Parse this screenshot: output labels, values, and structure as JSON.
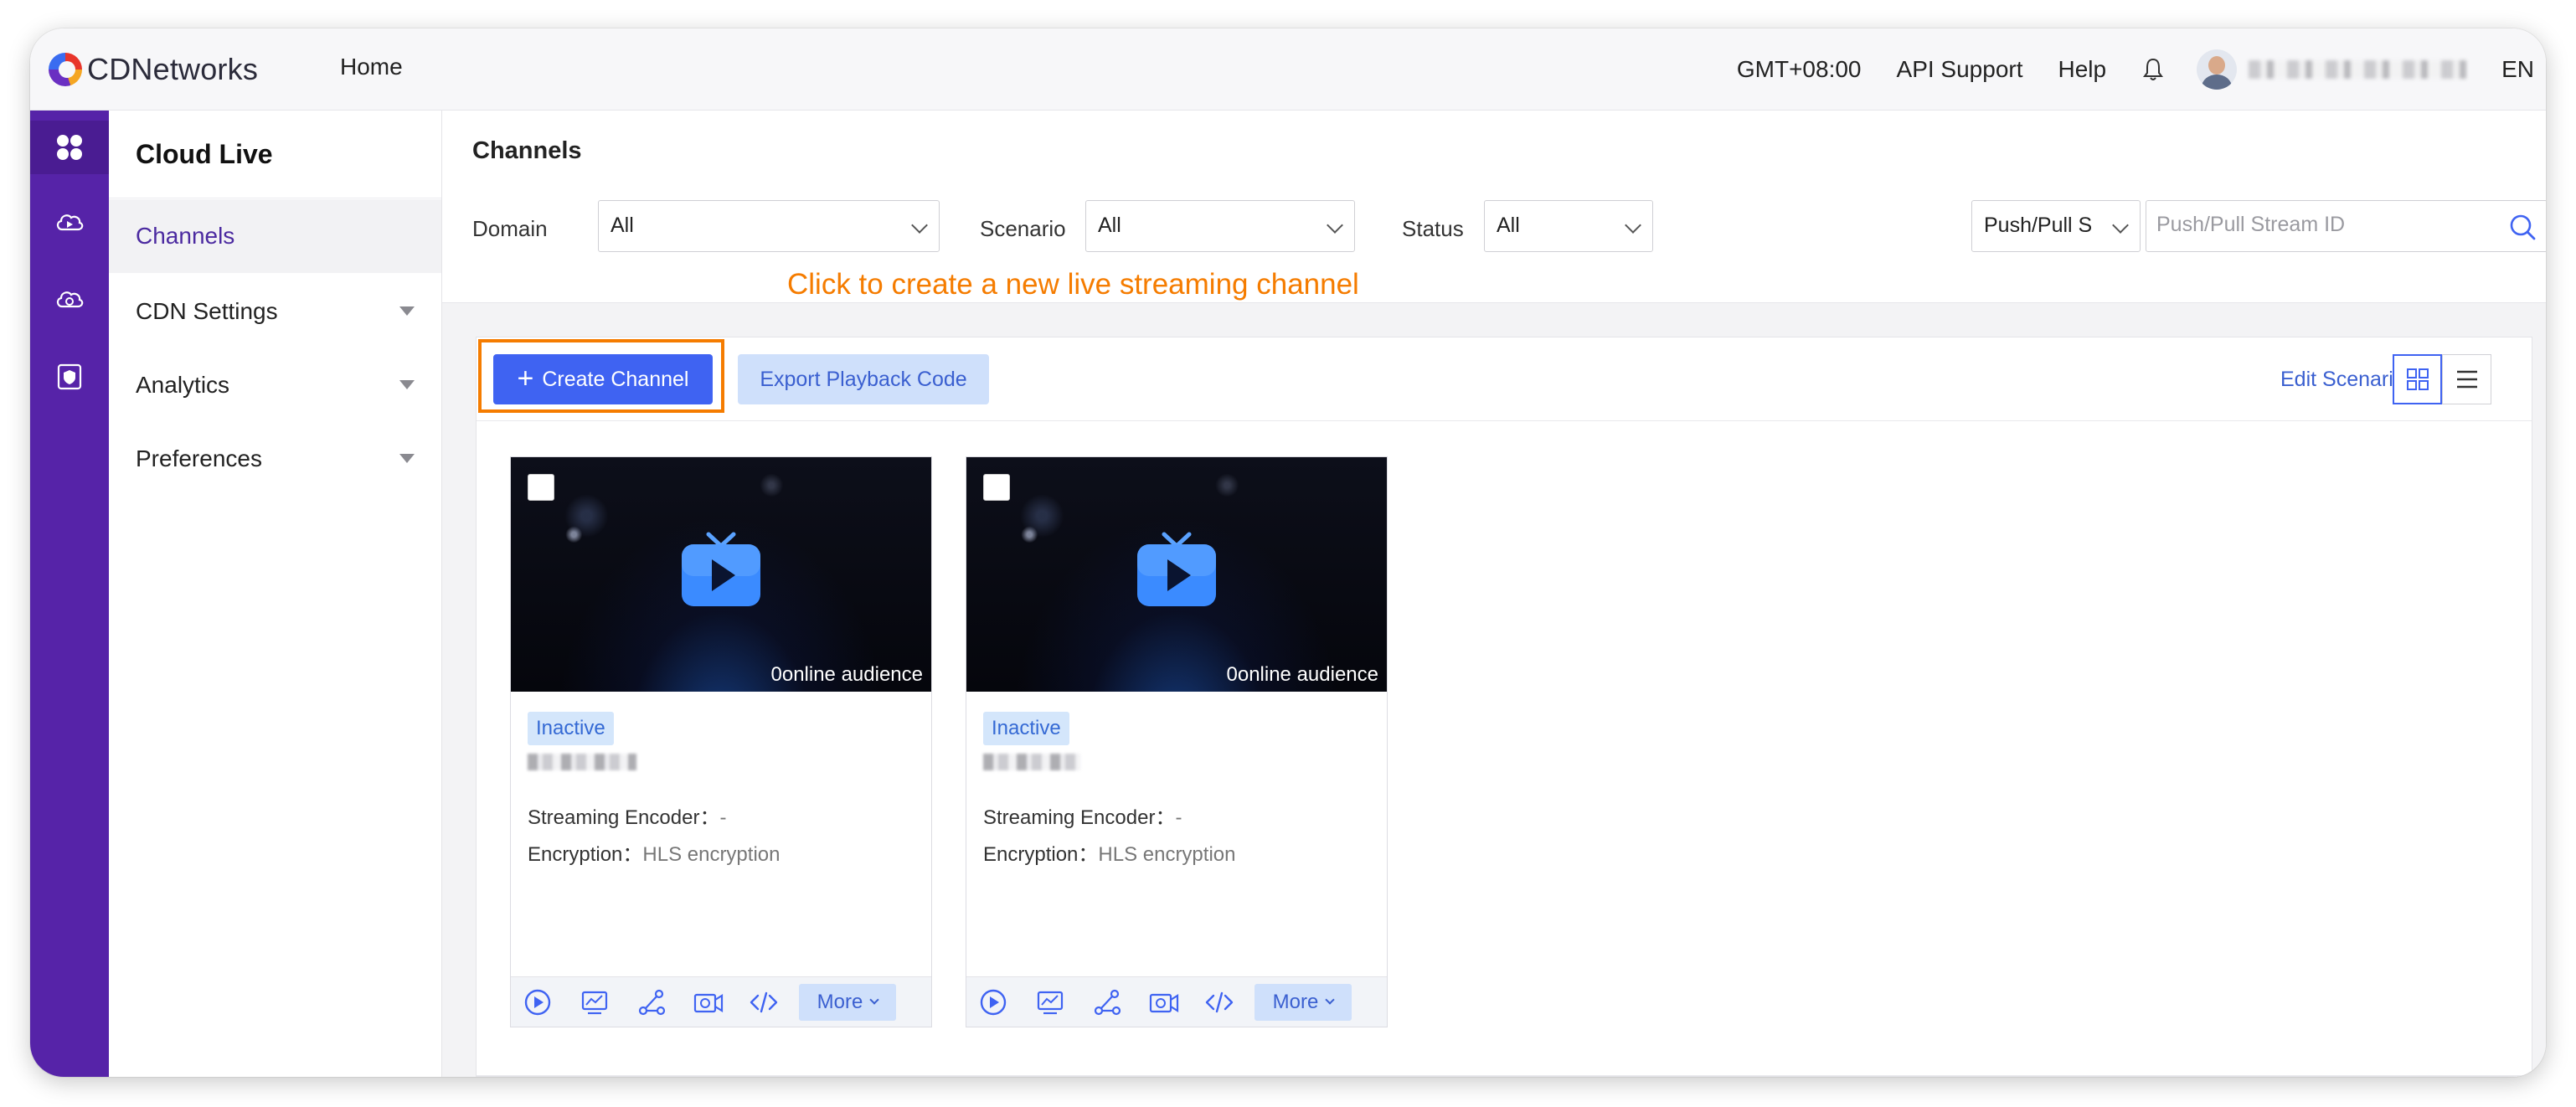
{
  "topbar": {
    "brand": "CDNetworks",
    "home": "Home",
    "timezone": "GMT+08:00",
    "api_support": "API Support",
    "help": "Help",
    "language": "EN"
  },
  "sidebar": {
    "title": "Cloud Live",
    "items": [
      {
        "label": "Channels",
        "active": true
      },
      {
        "label": "CDN Settings",
        "expandable": true
      },
      {
        "label": "Analytics",
        "expandable": true
      },
      {
        "label": "Preferences",
        "expandable": true
      }
    ]
  },
  "rail": {
    "icons": [
      "apps-grid-icon",
      "cloud-live-icon",
      "cloud-settings-icon",
      "security-shield-icon"
    ]
  },
  "filters": {
    "page_title": "Channels",
    "domain_label": "Domain",
    "domain_value": "All",
    "scenario_label": "Scenario",
    "scenario_value": "All",
    "status_label": "Status",
    "status_value": "All",
    "stream_type_value": "Push/Pull S",
    "search_placeholder": "Push/Pull Stream ID",
    "hint": "Click to create a new live streaming channel"
  },
  "toolbar": {
    "create_label": "Create Channel",
    "export_label": "Export Playback Code",
    "edit_scenario_label": "Edit Scenario"
  },
  "cards": [
    {
      "audience": "0online audience",
      "status": "Inactive",
      "encoder_label": "Streaming Encoder：",
      "encoder_value": "-",
      "encryption_label": "Encryption：",
      "encryption_value": "HLS encryption",
      "more_label": "More"
    },
    {
      "audience": "0online audience",
      "status": "Inactive",
      "encoder_label": "Streaming Encoder：",
      "encoder_value": "-",
      "encryption_label": "Encryption：",
      "encryption_value": "HLS encryption",
      "more_label": "More"
    }
  ],
  "colors": {
    "rail": "#5623a8",
    "primary": "#3f63f2",
    "highlight": "#f57c00",
    "active_nav_text": "#4b2aa0"
  }
}
